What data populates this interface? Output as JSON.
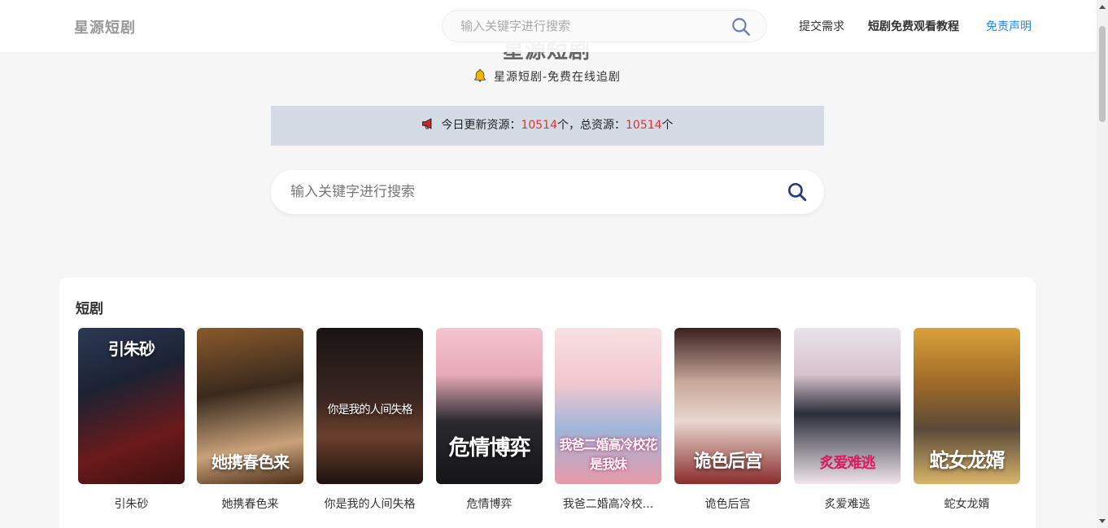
{
  "header": {
    "brand": "星源短剧",
    "search_placeholder": "输入关键字进行搜索",
    "nav": [
      "提交需求",
      "短剧免费观看教程",
      "免责声明"
    ]
  },
  "hero": {
    "title": "星源短剧",
    "subtitle": "星源短剧-免费在线追剧"
  },
  "notice": {
    "prefix": "今日更新资源：",
    "today_count": "10514",
    "mid": "个，总资源：",
    "total_count": "10514",
    "suffix": "个"
  },
  "main_search": {
    "placeholder": "输入关键字进行搜索"
  },
  "section": {
    "title": "短剧",
    "items": [
      {
        "title": "引朱砂",
        "poster_text": "引朱砂"
      },
      {
        "title": "她携春色来",
        "poster_text": "她携春色来"
      },
      {
        "title": "你是我的人间失格",
        "poster_text": "你是我的人间失格"
      },
      {
        "title": "危情博弈",
        "poster_text": "危情博弈"
      },
      {
        "title": "我爸二婚高冷校...",
        "poster_text": "我爸二婚高冷校花是我妹"
      },
      {
        "title": "诡色后宫",
        "poster_text": "诡色后宫"
      },
      {
        "title": "炙爱难逃",
        "poster_text": "炙爱难逃"
      },
      {
        "title": "蛇女龙婿",
        "poster_text": "蛇女龙婿"
      }
    ]
  },
  "colors": {
    "accent_blue": "#1e88e5",
    "count_red": "#dd3333",
    "notice_bg": "#d4dbe5",
    "search_icon": "#1e3a8a"
  },
  "icons": {
    "search": "search-icon",
    "bell": "bell-icon",
    "megaphone": "megaphone-icon"
  }
}
